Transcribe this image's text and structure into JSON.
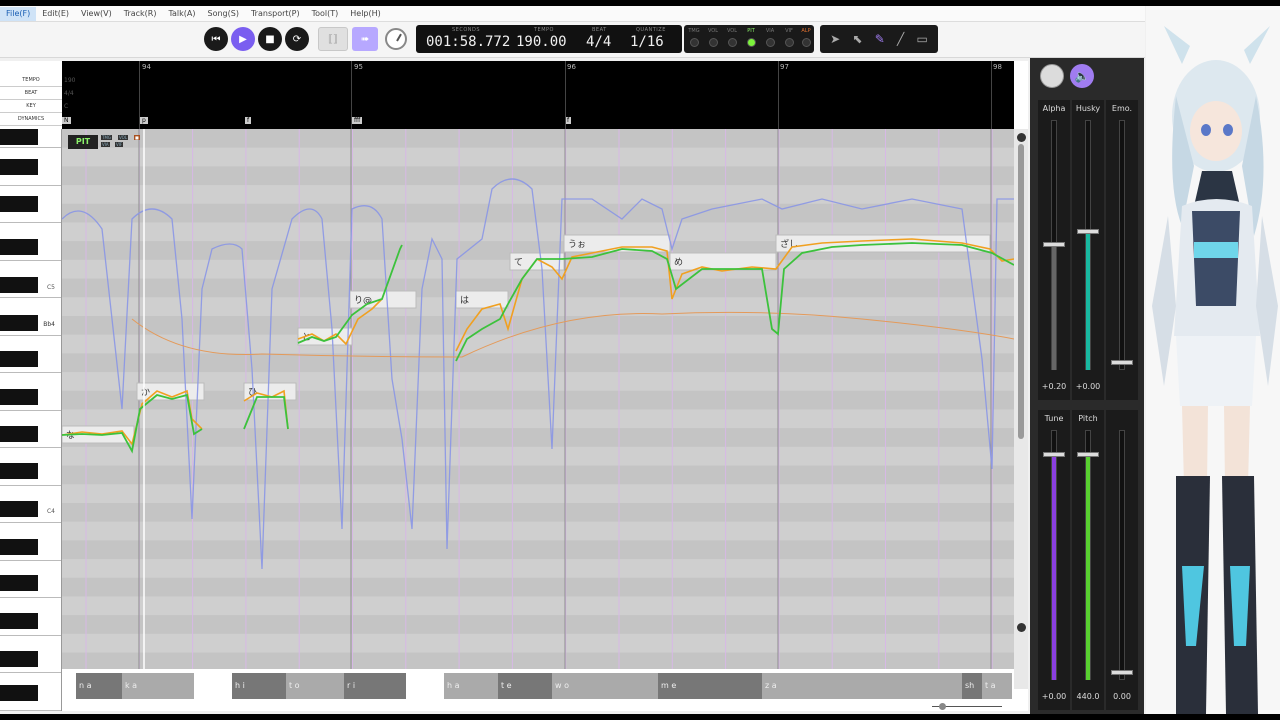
{
  "menu": [
    "File(F)",
    "Edit(E)",
    "View(V)",
    "Track(R)",
    "Talk(A)",
    "Song(S)",
    "Transport(P)",
    "Tool(T)",
    "Help(H)"
  ],
  "transport": {
    "seconds_caption": "SECONDS",
    "tempo_caption": "TEMPO",
    "beat_caption": "BEAT",
    "quantize_caption": "QUANTIZE",
    "seconds": "001:58.772",
    "tempo": "190.00",
    "beat": "4/4",
    "quantize": "1/16"
  },
  "toggles": [
    {
      "label": "TMG",
      "on": false
    },
    {
      "label": "VOL",
      "on": false
    },
    {
      "label": "PIT",
      "on": true
    },
    {
      "label": "VIA",
      "on": false
    },
    {
      "label": "VIF",
      "on": false
    },
    {
      "label": "ALP",
      "on": false
    }
  ],
  "tools": [
    "arrow-tool-icon",
    "select-tool-icon",
    "pencil-tool-icon",
    "line-tool-icon",
    "eraser-tool-icon"
  ],
  "ruler": {
    "labels": [
      "TEMPO",
      "BEAT",
      "KEY",
      "DYNAMICS"
    ],
    "tempo_value": "190",
    "beat_value": "4/4",
    "key_value": "C",
    "measures": [
      "94",
      "95",
      "96",
      "97",
      "98"
    ],
    "dynamics": [
      "N",
      "p",
      "f",
      "fff",
      "f"
    ]
  },
  "keyboard": {
    "labels": [
      "C5",
      "Bb4",
      "C4"
    ]
  },
  "pit_panel": {
    "label": "PIT",
    "minis": [
      "TMG",
      "VOL",
      "VIA",
      "VIF"
    ]
  },
  "notes": [
    {
      "lyric": "な"
    },
    {
      "lyric": "か"
    },
    {
      "lyric": "ひ"
    },
    {
      "lyric": "と"
    },
    {
      "lyric": "り@"
    },
    {
      "lyric": "は"
    },
    {
      "lyric": "て"
    },
    {
      "lyric": "うぉ"
    },
    {
      "lyric": "め"
    },
    {
      "lyric": "ざし"
    }
  ],
  "phonemes": [
    "n a",
    "k a",
    "h i",
    "t o",
    "r i",
    "h a",
    "t e",
    "w o",
    "m e",
    "z a",
    "sh",
    "t a"
  ],
  "mixer": {
    "knob_icon": "circle-knob-icon",
    "speaker_icon": "speaker-icon",
    "faders": [
      {
        "name": "Alpha",
        "value": "+0.20",
        "color": "#666666"
      },
      {
        "name": "Husky",
        "value": "+0.00",
        "color": "#18b8a0"
      },
      {
        "name": "Emo.",
        "value": "",
        "color": "#444444"
      },
      {
        "name": "Tune",
        "value": "+0.00",
        "color": "#8a3fe0"
      },
      {
        "name": "Pitch",
        "value": "440.0",
        "color": "#58d030"
      },
      {
        "name": "",
        "value": "0.00",
        "color": "#444444"
      }
    ]
  },
  "colors": {
    "accent": "#7a5ef0",
    "pitch_line_green": "#3cc23c",
    "pitch_line_orange": "#f0a020",
    "parameter_line_blue": "#8a96e6",
    "note_fill": "#ececec"
  }
}
